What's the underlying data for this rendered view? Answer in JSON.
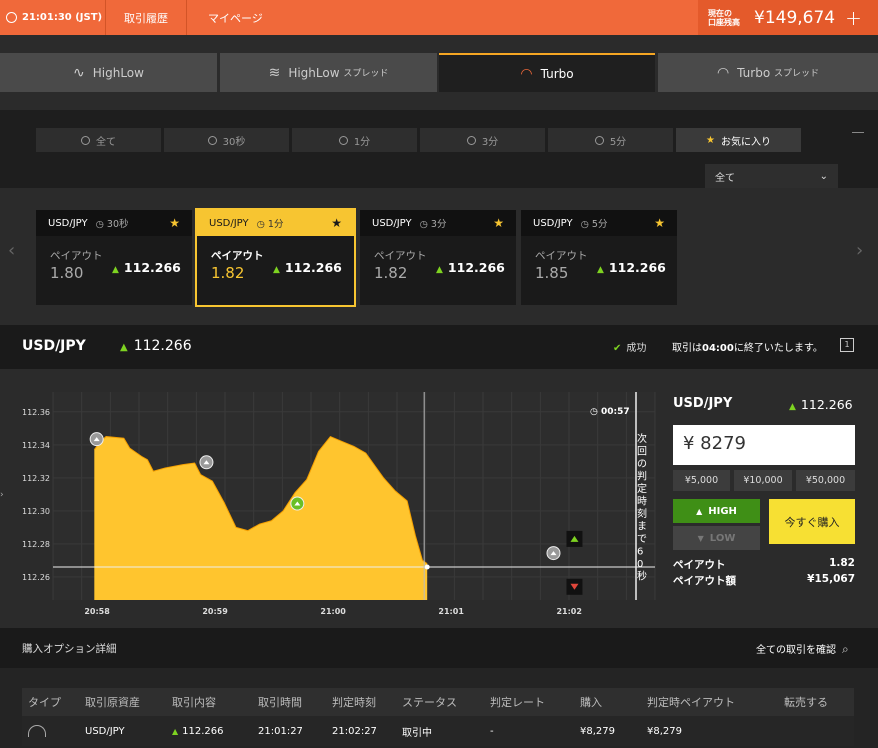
{
  "topbar": {
    "clock": "21:01:30 (JST)",
    "nav": [
      "取引履歴",
      "マイページ"
    ],
    "balance_label_1": "現在の",
    "balance_label_2": "口座残高",
    "balance": "¥149,674",
    "plus": "+"
  },
  "modes": [
    {
      "label": "HighLow",
      "suffix": ""
    },
    {
      "label": "HighLow",
      "suffix": "スプレッド"
    },
    {
      "label": "Turbo",
      "suffix": ""
    },
    {
      "label": "Turbo",
      "suffix": "スプレッド"
    }
  ],
  "durations": [
    "全て",
    "30秒",
    "1分",
    "3分",
    "5分",
    "お気に入り"
  ],
  "filter_select": "全て",
  "cards": [
    {
      "pair": "USD/JPY",
      "time": "30秒",
      "payout_label": "ペイアウト",
      "payout": "1.80",
      "rate": "112.266"
    },
    {
      "pair": "USD/JPY",
      "time": "1分",
      "payout_label": "ペイアウト",
      "payout": "1.82",
      "rate": "112.266"
    },
    {
      "pair": "USD/JPY",
      "time": "3分",
      "payout_label": "ペイアウト",
      "payout": "1.82",
      "rate": "112.266"
    },
    {
      "pair": "USD/JPY",
      "time": "5分",
      "payout_label": "ペイアウト",
      "payout": "1.85",
      "rate": "112.266"
    }
  ],
  "asset": {
    "pair": "USD/JPY",
    "rate": "112.266",
    "status": "成功",
    "message_pre": "取引は",
    "message_time": "04:00",
    "message_post": "に終了いたします。"
  },
  "chart_data": {
    "type": "area",
    "y_ticks": [
      "112.36",
      "112.34",
      "112.32",
      "112.30",
      "112.28",
      "112.26"
    ],
    "x_ticks": [
      "20:58",
      "20:59",
      "21:00",
      "21:01",
      "21:02"
    ],
    "ylim": [
      112.246,
      112.372
    ],
    "countdown": "00:57",
    "vertical_label": "次回の判定時刻まで60秒",
    "series": [
      {
        "values": [
          [
            0,
            112.337
          ],
          [
            0.05,
            112.342
          ],
          [
            0.1,
            112.345
          ],
          [
            0.25,
            112.344
          ],
          [
            0.3,
            112.338
          ],
          [
            0.4,
            112.333
          ],
          [
            0.45,
            112.331
          ],
          [
            0.5,
            112.324
          ],
          [
            0.6,
            112.326
          ],
          [
            0.75,
            112.328
          ],
          [
            0.85,
            112.329
          ],
          [
            0.9,
            112.322
          ],
          [
            1.0,
            112.318
          ],
          [
            1.1,
            112.305
          ],
          [
            1.2,
            112.29
          ],
          [
            1.3,
            112.288
          ],
          [
            1.4,
            112.292
          ],
          [
            1.5,
            112.294
          ],
          [
            1.6,
            112.3
          ],
          [
            1.7,
            112.311
          ],
          [
            1.8,
            112.319
          ],
          [
            1.9,
            112.336
          ],
          [
            2.0,
            112.345
          ],
          [
            2.1,
            112.342
          ],
          [
            2.2,
            112.339
          ],
          [
            2.3,
            112.335
          ],
          [
            2.45,
            112.32
          ],
          [
            2.55,
            112.312
          ],
          [
            2.65,
            112.306
          ],
          [
            2.72,
            112.285
          ],
          [
            2.78,
            112.27
          ],
          [
            2.82,
            112.268
          ]
        ]
      }
    ],
    "current_rate": 112.266,
    "markers": [
      {
        "x": 0.02,
        "y": 112.341
      },
      {
        "x": 0.95,
        "y": 112.327
      },
      {
        "x": 1.72,
        "y": 112.302
      },
      {
        "x": 3.89,
        "y": 112.272
      }
    ]
  },
  "panel": {
    "pair": "USD/JPY",
    "rate": "112.266",
    "amount": "¥ 8279",
    "presets": [
      "¥5,000",
      "¥10,000",
      "¥50,000"
    ],
    "high": "HIGH",
    "low": "LOW",
    "buy_now": "今すぐ購入",
    "payout_label": "ペイアウト",
    "payout": "1.82",
    "payout_amount_label": "ペイアウト額",
    "payout_amount": "¥15,067"
  },
  "details": {
    "title": "購入オプション詳細",
    "view_all": "全ての取引を確認",
    "headers": [
      "タイプ",
      "取引原資産",
      "取引内容",
      "取引時間",
      "判定時刻",
      "ステータス",
      "判定レート",
      "購入",
      "判定時ペイアウト",
      "転売する"
    ],
    "row": [
      "",
      "USD/JPY",
      "112.266",
      "21:01:27",
      "21:02:27",
      "取引中",
      "-",
      "¥8,279",
      "¥8,279",
      ""
    ]
  }
}
